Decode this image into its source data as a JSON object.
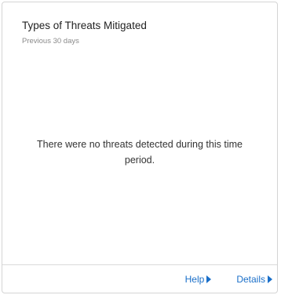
{
  "card": {
    "title": "Types of Threats Mitigated",
    "subtitle": "Previous 30 days",
    "empty_message": "There were no threats detected during this time period."
  },
  "footer": {
    "help_label": "Help",
    "details_label": "Details",
    "link_icon": "triangle-right-icon"
  },
  "colors": {
    "link": "#1a6fc9",
    "border": "#d4d4d4",
    "title_text": "#222222",
    "subtitle_text": "#8a8a8a"
  }
}
